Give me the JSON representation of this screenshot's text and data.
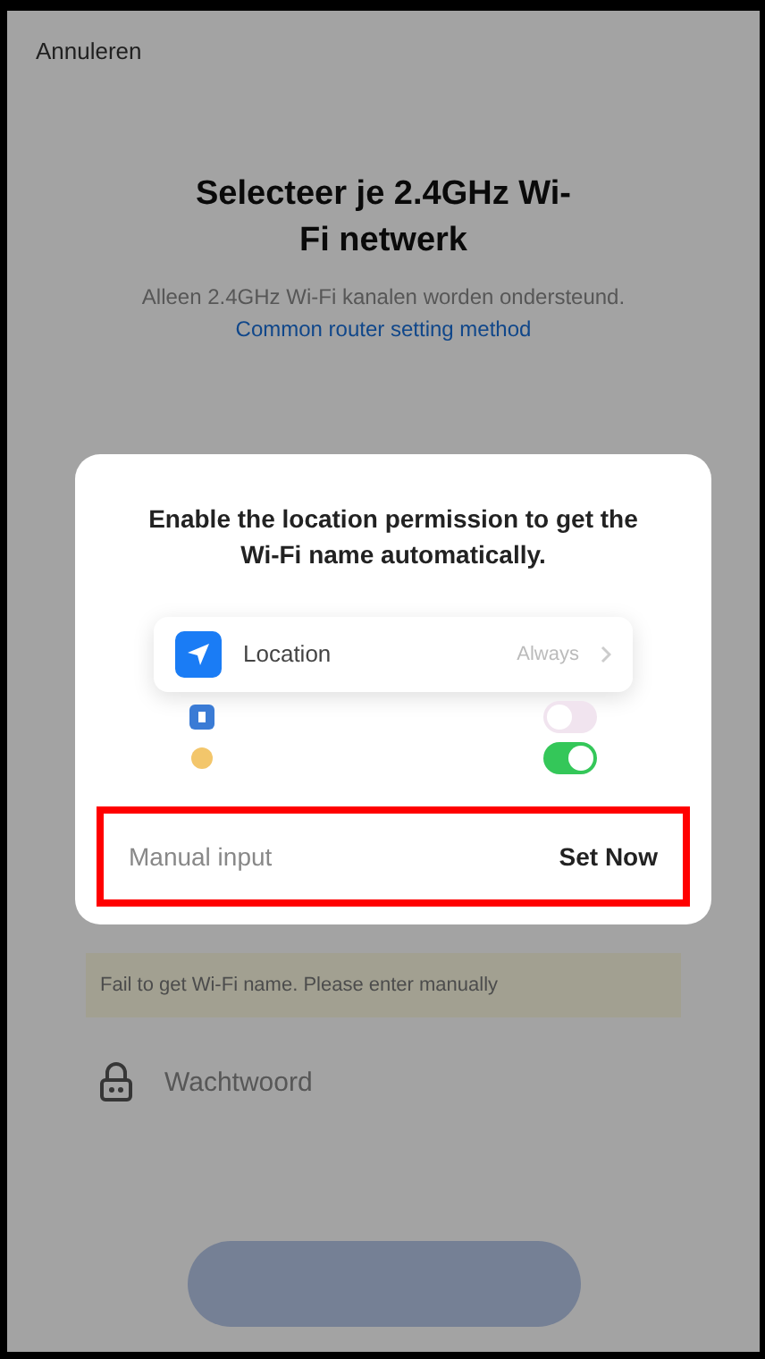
{
  "header": {
    "cancel": "Annuleren"
  },
  "title": "Selecteer je 2.4GHz Wi-Fi netwerk",
  "subtitle": {
    "text": "Alleen 2.4GHz Wi-Fi kanalen worden ondersteund.",
    "link": "Common router setting method"
  },
  "warning": "Fail to get Wi-Fi name. Please enter manually",
  "password": {
    "placeholder": "Wachtwoord"
  },
  "dialog": {
    "message": "Enable the location permission to get the Wi-Fi name automatically.",
    "illustration": {
      "setting": {
        "label": "Location",
        "value": "Always"
      },
      "rows": [
        {
          "kind": "square",
          "on": false
        },
        {
          "kind": "dot",
          "on": true
        }
      ]
    },
    "actions": {
      "highlighted": true,
      "buttons": [
        {
          "label": "Manual input",
          "kind": "secondary"
        },
        {
          "label": "Set Now",
          "kind": "primary"
        }
      ]
    }
  }
}
